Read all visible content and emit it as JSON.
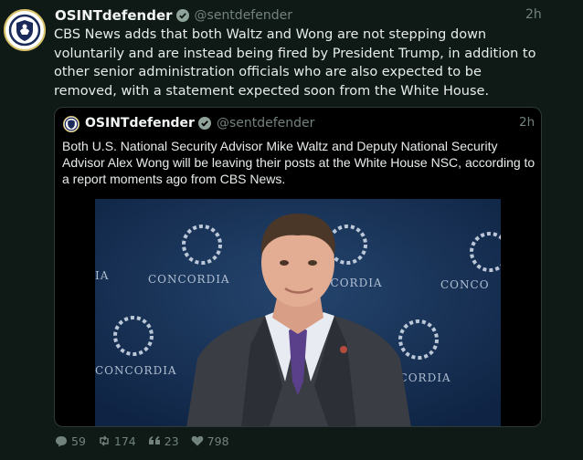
{
  "post": {
    "author_name": "OSINTdefender",
    "handle": "@sentdefender",
    "time": "2h",
    "text": "CBS News adds that both Waltz and Wong are not stepping down voluntarily and are instead being fired by President Trump, in addition to other senior administration officials who are also expected to be removed, with a statement expected soon from the White House."
  },
  "quote": {
    "author_name": "OSINTdefender",
    "handle": "@sentdefender",
    "time": "2h",
    "text": "Both U.S. National Security Advisor Mike Waltz and Deputy National Security Advisor Alex Wong will be leaving their posts at the White House NSC, according to a report moments ago from CBS News.",
    "photo": {
      "backdrop_text": [
        "CONCORDIA",
        "CONCORDIA",
        "CONCO",
        "CONCORDIA",
        "CONCORDIA",
        "IA"
      ]
    }
  },
  "actions": {
    "replies": "59",
    "reposts": "174",
    "quotes": "23",
    "likes": "798"
  },
  "colors": {
    "background": "#0f1a17",
    "muted": "#72827c",
    "verified": "#1d9bf0",
    "quote_bg": "#000000"
  },
  "icons": [
    "shield-avatar-icon",
    "verified-badge-icon",
    "reply-icon",
    "repost-icon",
    "quote-icon",
    "like-icon"
  ]
}
